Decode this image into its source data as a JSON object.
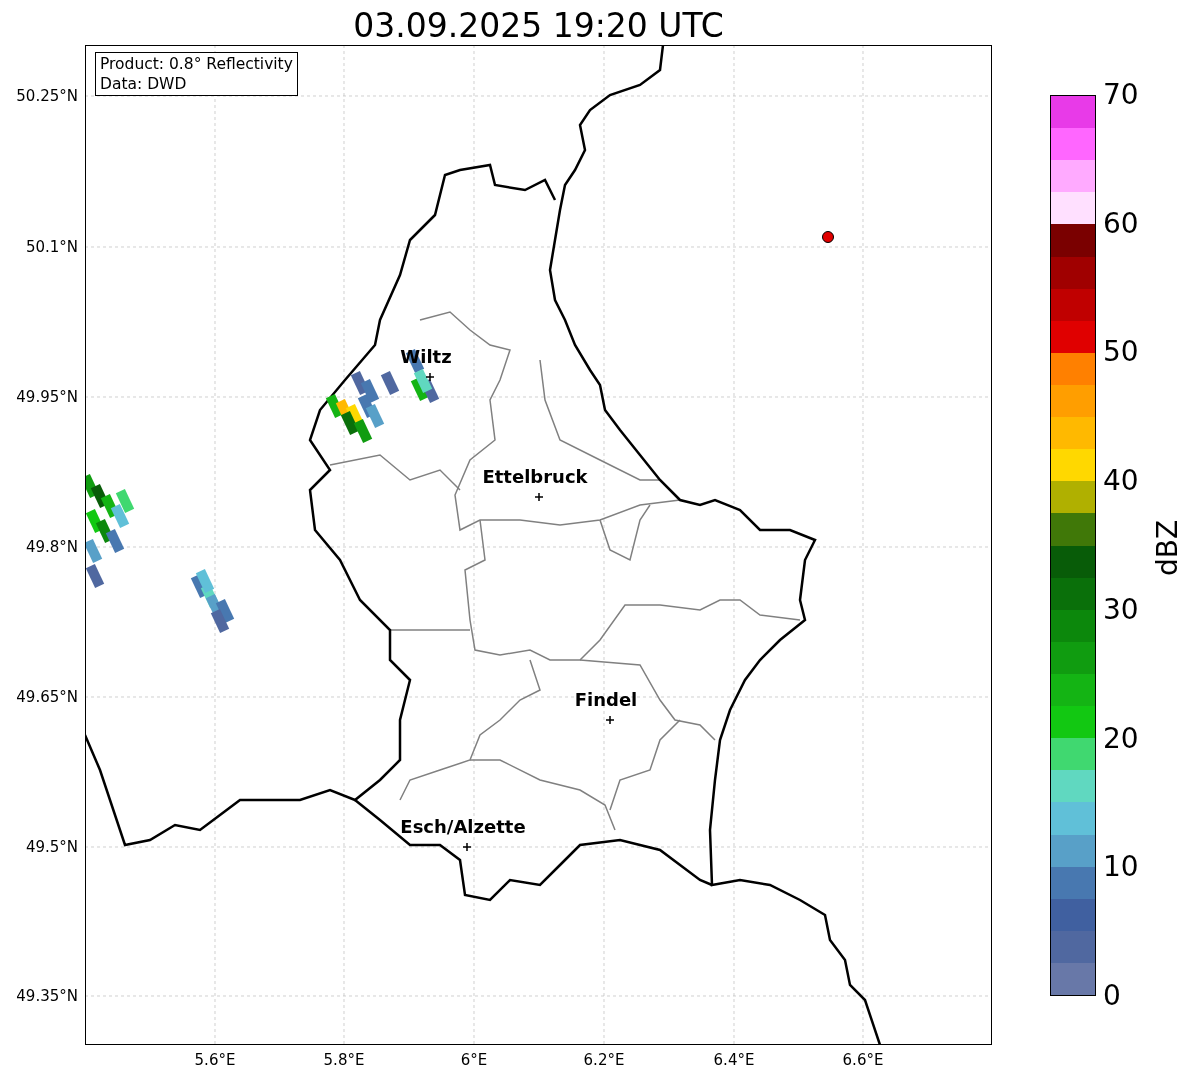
{
  "title": "03.09.2025 19:20 UTC",
  "info_box": [
    "Product: 0.8° Reflectivity",
    "Data: DWD"
  ],
  "y_ticks": [
    "50.25°N",
    "50.1°N",
    "49.95°N",
    "49.8°N",
    "49.65°N",
    "49.5°N",
    "49.35°N"
  ],
  "x_ticks": [
    "5.6°E",
    "5.8°E",
    "6°E",
    "6.2°E",
    "6.4°E",
    "6.6°E"
  ],
  "cities": [
    {
      "name": "Wiltz"
    },
    {
      "name": "Ettelbruck"
    },
    {
      "name": "Findel"
    },
    {
      "name": "Esch/Alzette"
    }
  ],
  "colorbar": {
    "label": "dBZ",
    "ticks": [
      "70",
      "60",
      "50",
      "40",
      "30",
      "20",
      "10",
      "0"
    ],
    "bins": [
      {
        "color": "#e83ae8"
      },
      {
        "color": "#ff66ff"
      },
      {
        "color": "#ffaaff"
      },
      {
        "color": "#ffe0ff"
      },
      {
        "color": "#7a0000"
      },
      {
        "color": "#a00000"
      },
      {
        "color": "#c00000"
      },
      {
        "color": "#e00000"
      },
      {
        "color": "#ff8000"
      },
      {
        "color": "#ff9e00"
      },
      {
        "color": "#ffb900"
      },
      {
        "color": "#ffd800"
      },
      {
        "color": "#b0b000"
      },
      {
        "color": "#407808"
      },
      {
        "color": "#085c08"
      },
      {
        "color": "#0a700a"
      },
      {
        "color": "#0c880c"
      },
      {
        "color": "#109c10"
      },
      {
        "color": "#14b414"
      },
      {
        "color": "#12c812"
      },
      {
        "color": "#40d870"
      },
      {
        "color": "#60d8c0"
      },
      {
        "color": "#60c0d8"
      },
      {
        "color": "#58a0c8"
      },
      {
        "color": "#4878b0"
      },
      {
        "color": "#4060a0"
      },
      {
        "color": "#5068a0"
      },
      {
        "color": "#6878a8"
      }
    ]
  }
}
